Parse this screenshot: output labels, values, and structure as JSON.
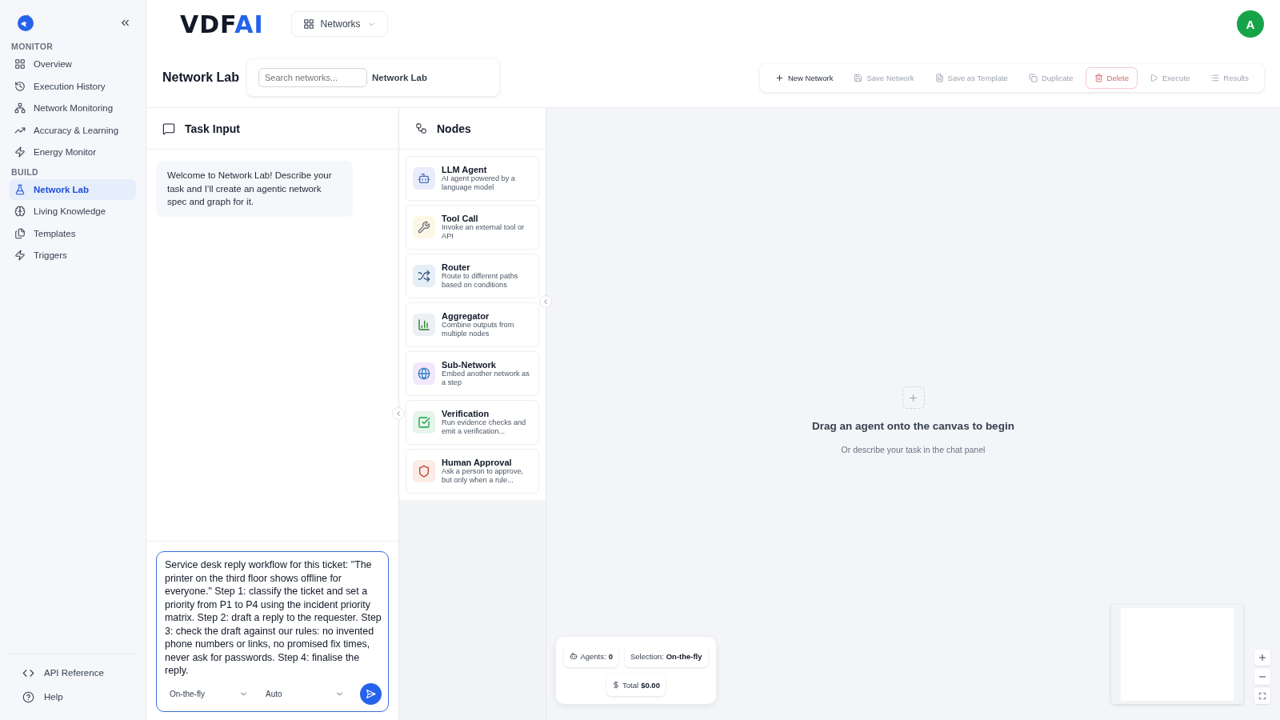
{
  "sidebar": {
    "sections": [
      {
        "title": "MONITOR",
        "items": [
          {
            "label": "Overview",
            "selected": false
          },
          {
            "label": "Execution History",
            "selected": false
          },
          {
            "label": "Network Monitoring",
            "selected": false
          },
          {
            "label": "Accuracy & Learning",
            "selected": false
          },
          {
            "label": "Energy Monitor",
            "selected": false
          }
        ]
      },
      {
        "title": "BUILD",
        "items": [
          {
            "label": "Network Lab",
            "selected": true
          },
          {
            "label": "Living Knowledge",
            "selected": false
          },
          {
            "label": "Templates",
            "selected": false
          },
          {
            "label": "Triggers",
            "selected": false
          }
        ]
      }
    ],
    "footer": [
      "API Reference",
      "Help"
    ]
  },
  "header": {
    "logo": {
      "main": "VDF",
      "accent": "AI"
    },
    "menu": "Networks",
    "avatar": "A"
  },
  "page": {
    "title": "Network Lab",
    "search": {
      "placeholder": "Search networks..."
    },
    "current": "Network Lab"
  },
  "toolbar": [
    {
      "label": "New Network",
      "kind": "normal",
      "disabled": false
    },
    {
      "label": "Save Network",
      "kind": "normal",
      "disabled": true
    },
    {
      "label": "Save as Template",
      "kind": "normal",
      "disabled": true
    },
    {
      "label": "Duplicate",
      "kind": "normal",
      "disabled": true
    },
    {
      "label": "Delete",
      "kind": "danger",
      "disabled": true
    },
    {
      "label": "Execute",
      "kind": "normal",
      "disabled": true
    },
    {
      "label": "Results",
      "kind": "normal",
      "disabled": true
    }
  ],
  "task_input": {
    "title": "Task Input",
    "messages": [
      "Welcome to Network Lab! Describe your task and I’ll create an agentic network spec and graph for it."
    ],
    "value": "Service desk reply workflow for this ticket: \"The printer on the third floor shows offline for everyone.\" Step 1: classify the ticket and set a priority from P1 to P4 using the incident priority matrix. Step 2: draft a reply to the requester. Step 3: check the draft against our rules: no invented phone numbers or links, no promised fix times, never ask for passwords. Step 4: finalise the reply.",
    "selection_mode": "On-the-fly",
    "model": "Auto"
  },
  "nodes": {
    "title": "Nodes",
    "items": [
      {
        "kind": "llm",
        "name": "LLM Agent",
        "description": "AI agent powered by a language model"
      },
      {
        "kind": "tool",
        "name": "Tool Call",
        "description": "Invoke an external tool or API"
      },
      {
        "kind": "router",
        "name": "Router",
        "description": "Route to different paths based on conditions"
      },
      {
        "kind": "aggregator",
        "name": "Aggregator",
        "description": "Combine outputs from multiple nodes"
      },
      {
        "kind": "subnetwork",
        "name": "Sub-Network",
        "description": "Embed another network as a step"
      },
      {
        "kind": "verification",
        "name": "Verification",
        "description": "Run evidence checks and emit a verification..."
      },
      {
        "kind": "approval",
        "name": "Human Approval",
        "description": "Ask a person to approve, but only when a rule..."
      }
    ]
  },
  "canvas": {
    "empty_title": "Drag an agent onto the canvas to begin",
    "empty_subtitle": "Or describe your task in the chat panel",
    "stats": [
      {
        "label": "Agents:",
        "value": "0"
      },
      {
        "label": "Selection:",
        "value": "On-the-fly"
      },
      {
        "label": "Total",
        "value": "$0.00"
      }
    ]
  }
}
